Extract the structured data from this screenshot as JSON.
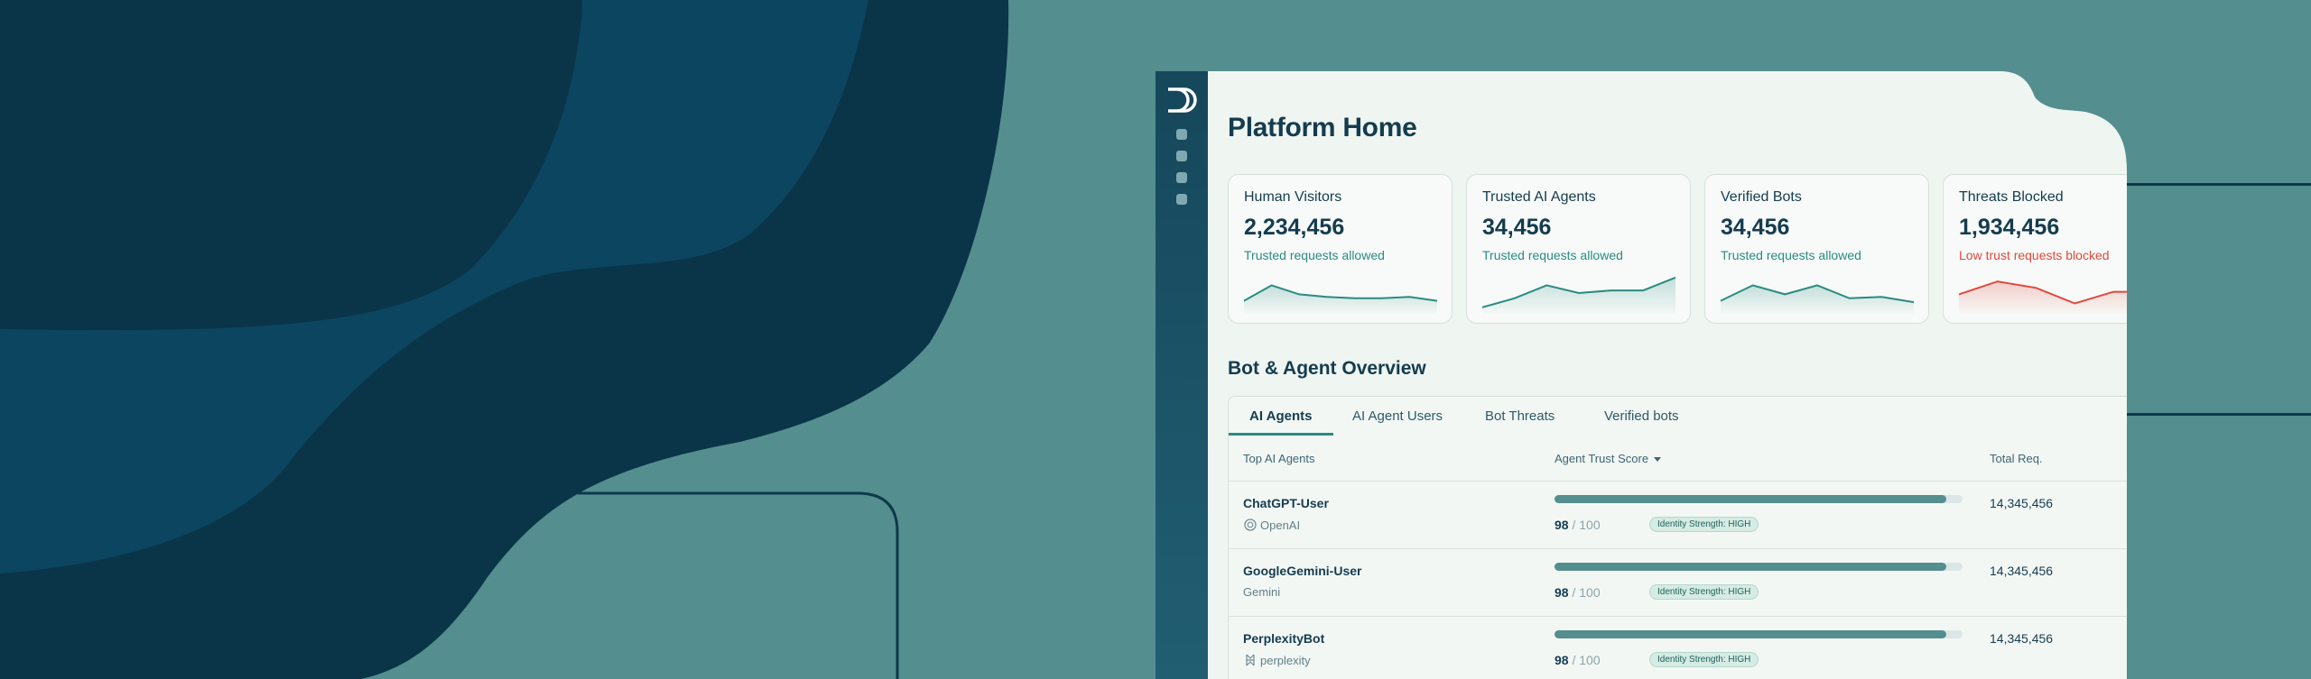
{
  "colors": {
    "page_bg": "#548e8e",
    "dark_blob": "#0a3548",
    "mid_blob": "#0c4560",
    "window_bg": "#eff5f1",
    "sidebar": "#16475b",
    "accent_teal": "#2a8b82",
    "alert_red": "#e1483d"
  },
  "app": {
    "page_title": "Platform Home",
    "sidebar": {
      "logo_icon": "dd-logo-icon",
      "nav_items": [
        "nav-dot-icon",
        "nav-dot-icon",
        "nav-dot-icon",
        "nav-dot-icon"
      ]
    }
  },
  "stats": [
    {
      "title": "Human Visitors",
      "value": "2,234,456",
      "caption": "Trusted requests allowed",
      "tone": "teal",
      "trend": [
        10,
        22,
        15,
        13,
        12,
        12,
        13,
        10
      ]
    },
    {
      "title": "Trusted AI Agents",
      "value": "34,456",
      "caption": "Trusted requests allowed",
      "tone": "teal",
      "trend": [
        5,
        12,
        22,
        16,
        18,
        18,
        28
      ]
    },
    {
      "title": "Verified Bots",
      "value": "34,456",
      "caption": "Trusted requests allowed",
      "tone": "teal",
      "trend": [
        10,
        22,
        15,
        22,
        12,
        13,
        9
      ]
    },
    {
      "title": "Threats Blocked",
      "value": "1,934,456",
      "caption": "Low trust requests blocked",
      "tone": "red",
      "trend": [
        15,
        25,
        20,
        8,
        17,
        17
      ]
    }
  ],
  "overview": {
    "title": "Bot & Agent Overview",
    "tabs": [
      "AI Agents",
      "AI Agent Users",
      "Bot Threats",
      "Verified bots"
    ],
    "active_tab": "AI Agents",
    "columns": {
      "agent": "Top AI Agents",
      "score": "Agent Trust Score",
      "total": "Total Req."
    },
    "rows": [
      {
        "name": "ChatGPT-User",
        "org": "OpenAI",
        "org_icon": "openai-icon",
        "score": "98",
        "max": "/ 100",
        "fill": 0.96,
        "badge": "Identity Strength: HIGH",
        "total": "14,345,456"
      },
      {
        "name": "GoogleGemini-User",
        "org": "Gemini",
        "org_icon": "gemini-icon",
        "score": "98",
        "max": "/ 100",
        "fill": 0.96,
        "badge": "Identity Strength: HIGH",
        "total": "14,345,456"
      },
      {
        "name": "PerplexityBot",
        "org": "perplexity",
        "org_icon": "perplexity-icon",
        "score": "98",
        "max": "/ 100",
        "fill": 0.96,
        "badge": "Identity Strength: HIGH",
        "total": "14,345,456"
      }
    ]
  }
}
